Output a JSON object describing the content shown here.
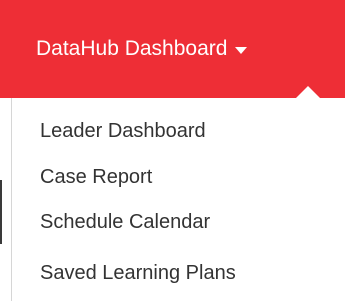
{
  "header": {
    "menu_title": "DataHub Dashboard",
    "caret_icon": "caret-down-icon",
    "background_color": "#ee2e36",
    "text_color": "#ffffff"
  },
  "dropdown": {
    "items": [
      {
        "label": "Leader Dashboard"
      },
      {
        "label": "Case Report"
      },
      {
        "label": "Schedule Calendar"
      },
      {
        "label": "Saved Learning Plans"
      }
    ],
    "text_color": "#333333"
  }
}
